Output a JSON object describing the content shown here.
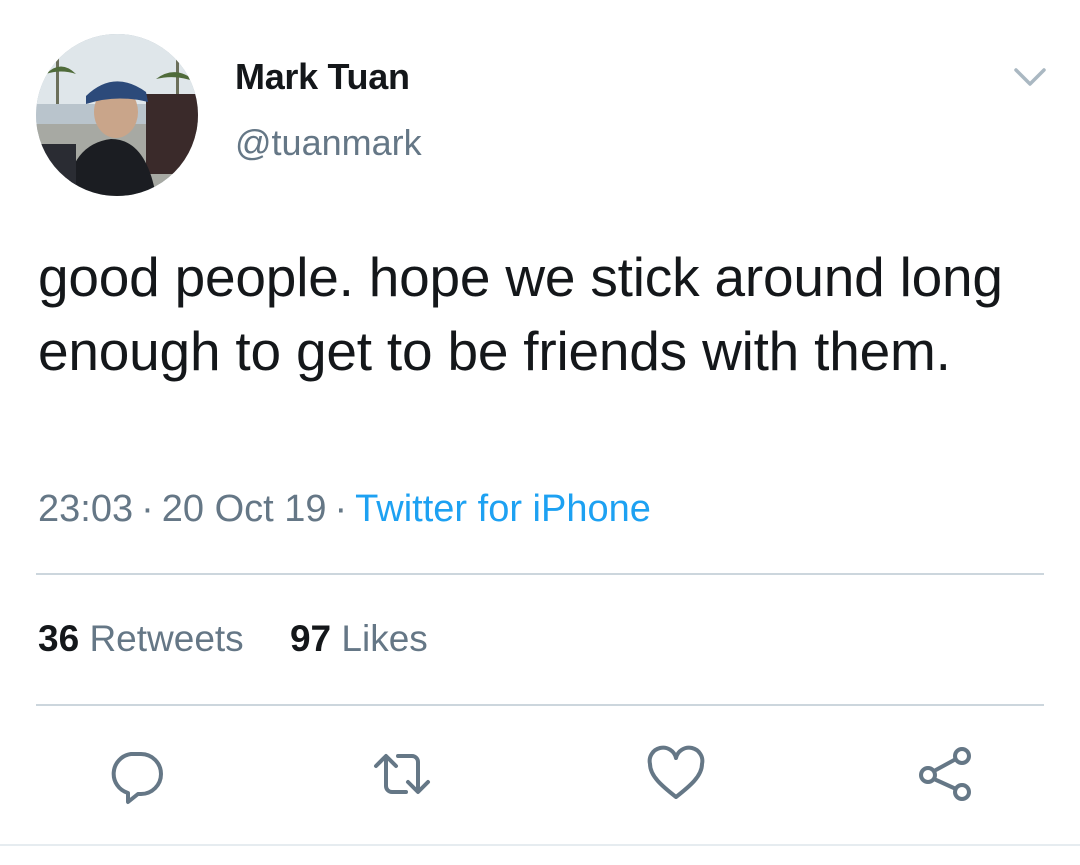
{
  "author": {
    "display_name": "Mark Tuan",
    "handle": "@tuanmark"
  },
  "tweet": {
    "text": "good people. hope we stick around long enough to get to be friends with them.",
    "time": "23:03",
    "date": "20 Oct 19",
    "separator": "·",
    "source": "Twitter for iPhone"
  },
  "stats": {
    "retweets_count": "36",
    "retweets_label": "Retweets",
    "likes_count": "97",
    "likes_label": "Likes"
  },
  "icons": {
    "caret": "chevron-down-icon",
    "reply": "reply-icon",
    "retweet": "retweet-icon",
    "like": "heart-icon",
    "share": "share-icon"
  },
  "colors": {
    "text_primary": "#14171a",
    "text_secondary": "#657786",
    "link": "#1da1f2",
    "divider": "#ccd6dd"
  }
}
